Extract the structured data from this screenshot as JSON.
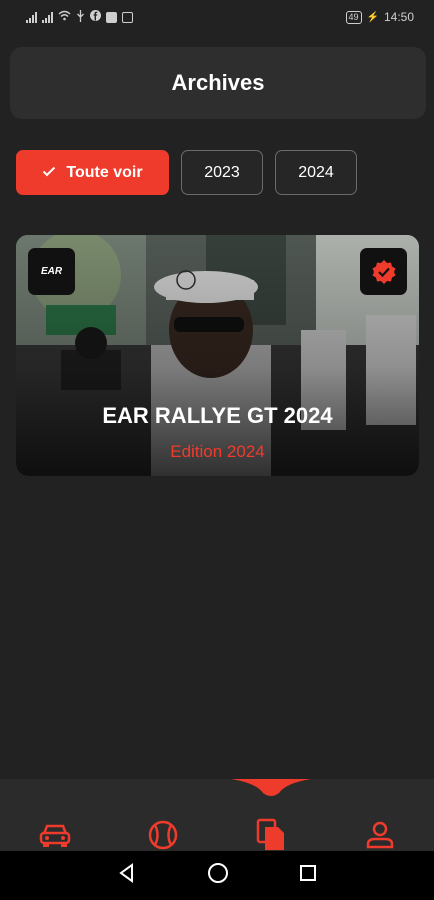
{
  "status_bar": {
    "time": "14:50",
    "battery": "49"
  },
  "header": {
    "title": "Archives"
  },
  "filters": {
    "items": [
      {
        "label": "Toute voir",
        "active": true
      },
      {
        "label": "2023",
        "active": false
      },
      {
        "label": "2024",
        "active": false
      }
    ]
  },
  "card": {
    "logo_text": "EAR",
    "title": "EAR RALLYE GT 2024",
    "subtitle": "Edition 2024"
  },
  "bottom_nav": {
    "items": [
      {
        "icon": "car-icon"
      },
      {
        "icon": "ball-icon"
      },
      {
        "icon": "documents-icon",
        "active": true
      },
      {
        "icon": "person-icon"
      }
    ]
  },
  "colors": {
    "accent": "#ef3b2c",
    "background": "#222222",
    "surface": "#2e2e2e"
  }
}
